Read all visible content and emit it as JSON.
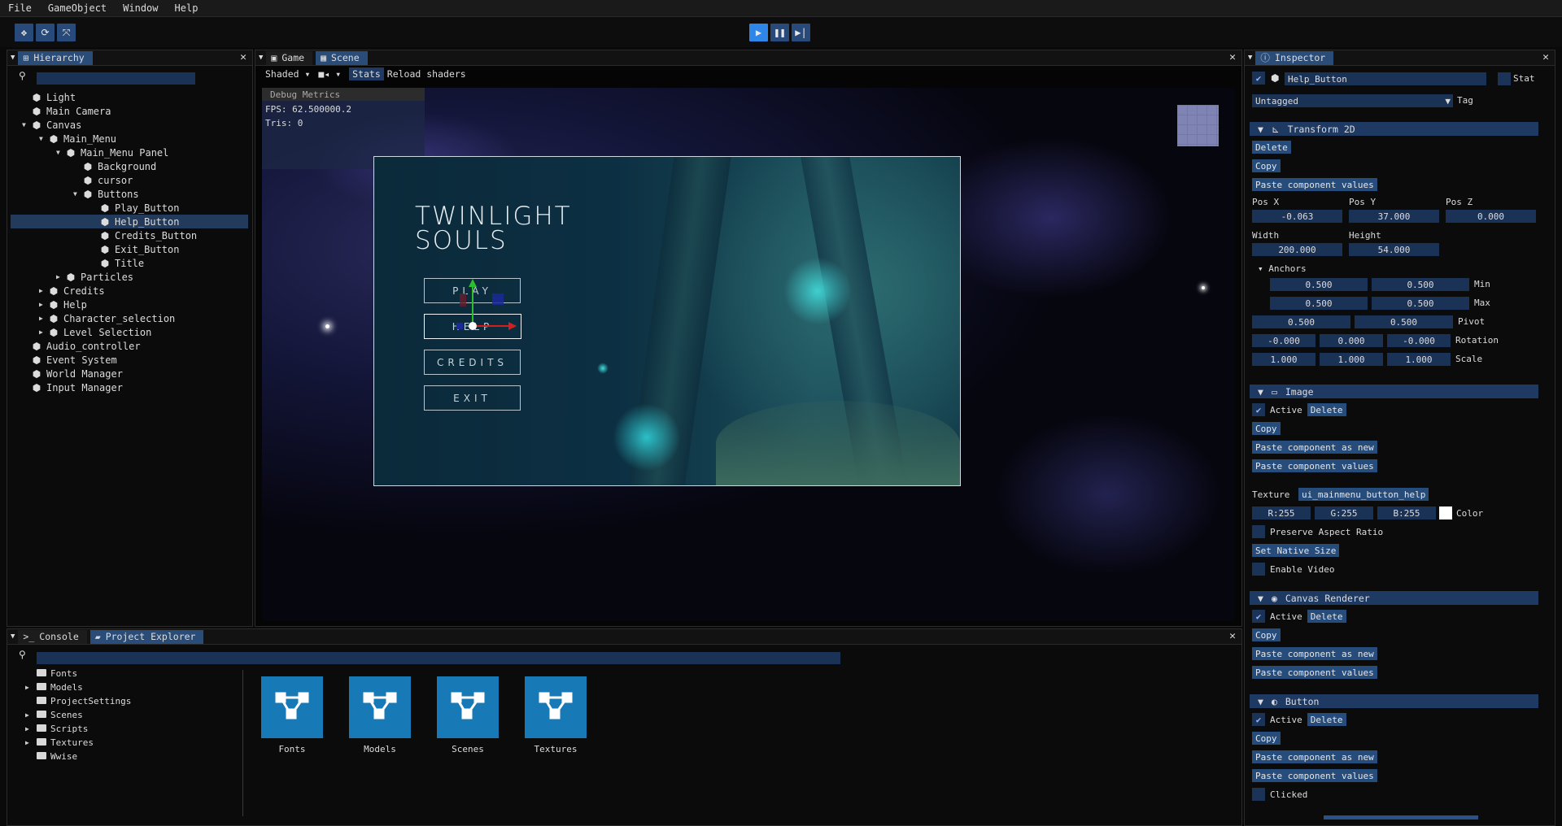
{
  "menu": [
    "File",
    "GameObject",
    "Window",
    "Help"
  ],
  "toolbar": {
    "left_icons": [
      "move-icon",
      "rotate-icon",
      "scale-icon"
    ],
    "play_icons": [
      "play-icon",
      "pause-icon",
      "step-icon"
    ]
  },
  "hierarchy": {
    "title": "Hierarchy",
    "items": [
      {
        "label": "Light",
        "indent": 0,
        "arrow": ""
      },
      {
        "label": "Main Camera",
        "indent": 0,
        "arrow": ""
      },
      {
        "label": "Canvas",
        "indent": 0,
        "arrow": "▼"
      },
      {
        "label": "Main_Menu",
        "indent": 1,
        "arrow": "▼"
      },
      {
        "label": "Main_Menu Panel",
        "indent": 2,
        "arrow": "▼"
      },
      {
        "label": "Background",
        "indent": 3,
        "arrow": ""
      },
      {
        "label": "cursor",
        "indent": 3,
        "arrow": ""
      },
      {
        "label": "Buttons",
        "indent": 3,
        "arrow": "▼"
      },
      {
        "label": "Play_Button",
        "indent": 4,
        "arrow": ""
      },
      {
        "label": "Help_Button",
        "indent": 4,
        "arrow": "",
        "selected": true
      },
      {
        "label": "Credits_Button",
        "indent": 4,
        "arrow": ""
      },
      {
        "label": "Exit_Button",
        "indent": 4,
        "arrow": ""
      },
      {
        "label": "Title",
        "indent": 4,
        "arrow": ""
      },
      {
        "label": "Particles",
        "indent": 2,
        "arrow": "▶"
      },
      {
        "label": "Credits",
        "indent": 1,
        "arrow": "▶"
      },
      {
        "label": "Help",
        "indent": 1,
        "arrow": "▶"
      },
      {
        "label": "Character_selection",
        "indent": 1,
        "arrow": "▶"
      },
      {
        "label": "Level Selection",
        "indent": 1,
        "arrow": "▶"
      },
      {
        "label": "Audio_controller",
        "indent": 0,
        "arrow": ""
      },
      {
        "label": "Event System",
        "indent": 0,
        "arrow": ""
      },
      {
        "label": "World Manager",
        "indent": 0,
        "arrow": ""
      },
      {
        "label": "Input Manager",
        "indent": 0,
        "arrow": ""
      }
    ]
  },
  "viewport": {
    "tabs": [
      "Game",
      "Scene"
    ],
    "shading": "Shaded",
    "stats": "Stats",
    "reload": "Reload shaders",
    "debug_title": "Debug Metrics",
    "fps": "FPS: 62.500000.2",
    "tris": "Tris: 0",
    "game_title_1": "TWINLIGHT",
    "game_title_2": "SOULS",
    "buttons": [
      "PLAY",
      "HELP",
      "CREDITS",
      "EXIT"
    ]
  },
  "inspector": {
    "title": "Inspector",
    "name": "Help_Button",
    "static": "Stat",
    "tag_value": "Untagged",
    "tag_label": "Tag",
    "transform": {
      "title": "Transform 2D",
      "delete": "Delete",
      "copy": "Copy",
      "paste_values": "Paste component values",
      "posx_label": "Pos X",
      "posy_label": "Pos Y",
      "posz_label": "Pos Z",
      "posx": "-0.063",
      "posy": "37.000",
      "posz": "0.000",
      "width_label": "Width",
      "height_label": "Height",
      "width": "200.000",
      "height": "54.000",
      "anchors": "Anchors",
      "min1": "0.500",
      "min2": "0.500",
      "min_label": "Min",
      "max1": "0.500",
      "max2": "0.500",
      "max_label": "Max",
      "pivot1": "0.500",
      "pivot2": "0.500",
      "pivot_label": "Pivot",
      "rot1": "-0.000",
      "rot2": "0.000",
      "rot3": "-0.000",
      "rot_label": "Rotation",
      "sc1": "1.000",
      "sc2": "1.000",
      "sc3": "1.000",
      "sc_label": "Scale"
    },
    "image": {
      "title": "Image",
      "active": "Active",
      "delete": "Delete",
      "copy": "Copy",
      "paste_new": "Paste component as new",
      "paste_values": "Paste component values",
      "texture_label": "Texture",
      "texture": "ui_mainmenu_button_help",
      "r": "R:255",
      "g": "G:255",
      "b": "B:255",
      "color_label": "Color",
      "preserve": "Preserve Aspect Ratio",
      "native": "Set Native Size",
      "video": "Enable Video"
    },
    "canvas_renderer": {
      "title": "Canvas Renderer",
      "active": "Active",
      "delete": "Delete",
      "copy": "Copy",
      "paste_new": "Paste component as new",
      "paste_values": "Paste component values"
    },
    "button": {
      "title": "Button",
      "active": "Active",
      "delete": "Delete",
      "copy": "Copy",
      "paste_new": "Paste component as new",
      "paste_values": "Paste component values",
      "clicked": "Clicked"
    }
  },
  "bottom": {
    "tabs": [
      "Console",
      "Project Explorer"
    ],
    "folders": [
      {
        "label": "Fonts",
        "arrow": ""
      },
      {
        "label": "Models",
        "arrow": "▶"
      },
      {
        "label": "ProjectSettings",
        "arrow": ""
      },
      {
        "label": "Scenes",
        "arrow": "▶"
      },
      {
        "label": "Scripts",
        "arrow": "▶"
      },
      {
        "label": "Textures",
        "arrow": "▶"
      },
      {
        "label": "Wwise",
        "arrow": ""
      }
    ],
    "assets": [
      "Fonts",
      "Models",
      "Scenes",
      "Textures"
    ]
  },
  "colors": {
    "accent": "#264c7c",
    "selected": "#223a5c",
    "section": "#1e3a63",
    "asset": "#1779b6"
  }
}
